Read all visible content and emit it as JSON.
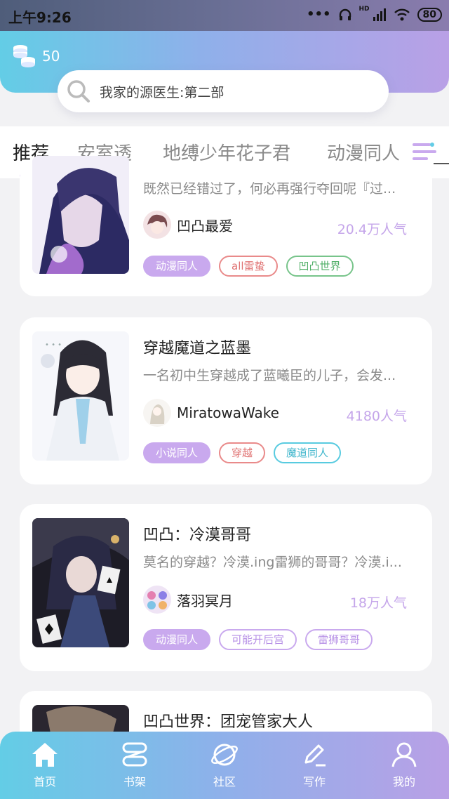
{
  "status_bar": {
    "time": "上午9:26",
    "network": "HD",
    "battery": "80"
  },
  "header": {
    "coins": "50",
    "search_placeholder": "我家的源医生:第二部"
  },
  "tabs": [
    {
      "label": "推荐",
      "active": true
    },
    {
      "label": "安室透",
      "active": false
    },
    {
      "label": "地缚少年花子君",
      "active": false
    },
    {
      "label": "动漫同人",
      "active": false
    }
  ],
  "cards": [
    {
      "title": "",
      "desc": "既然已经错过了，何必再强行夺回呢『过...",
      "author": "凹凸最爱",
      "popularity": "20.4万人气",
      "tags": [
        "动漫同人",
        "all雷蛰",
        "凹凸世界"
      ]
    },
    {
      "title": "穿越魔道之蓝墨",
      "desc": "一名初中生穿越成了蓝曦臣的儿子，会发...",
      "author": "MiratowaWake",
      "popularity": "4180人气",
      "tags": [
        "小说同人",
        "穿越",
        "魔道同人"
      ]
    },
    {
      "title": "凹凸：冷漠哥哥",
      "desc": "莫名的穿越？冷漠.ing雷狮的哥哥？冷漠.i...",
      "author": "落羽冥月",
      "popularity": "18万人气",
      "tags": [
        "动漫同人",
        "可能开后宫",
        "雷狮哥哥"
      ]
    },
    {
      "title": "凹凸世界：团宠管家大人"
    }
  ],
  "bottom_nav": [
    {
      "label": "首页",
      "icon": "home-icon"
    },
    {
      "label": "书架",
      "icon": "bookshelf-icon"
    },
    {
      "label": "社区",
      "icon": "planet-icon"
    },
    {
      "label": "写作",
      "icon": "pen-icon"
    },
    {
      "label": "我的",
      "icon": "user-icon"
    }
  ],
  "colors": {
    "accent": "#c4a6ec",
    "gradient_start": "#63cde6",
    "gradient_end": "#b9a0e6"
  }
}
